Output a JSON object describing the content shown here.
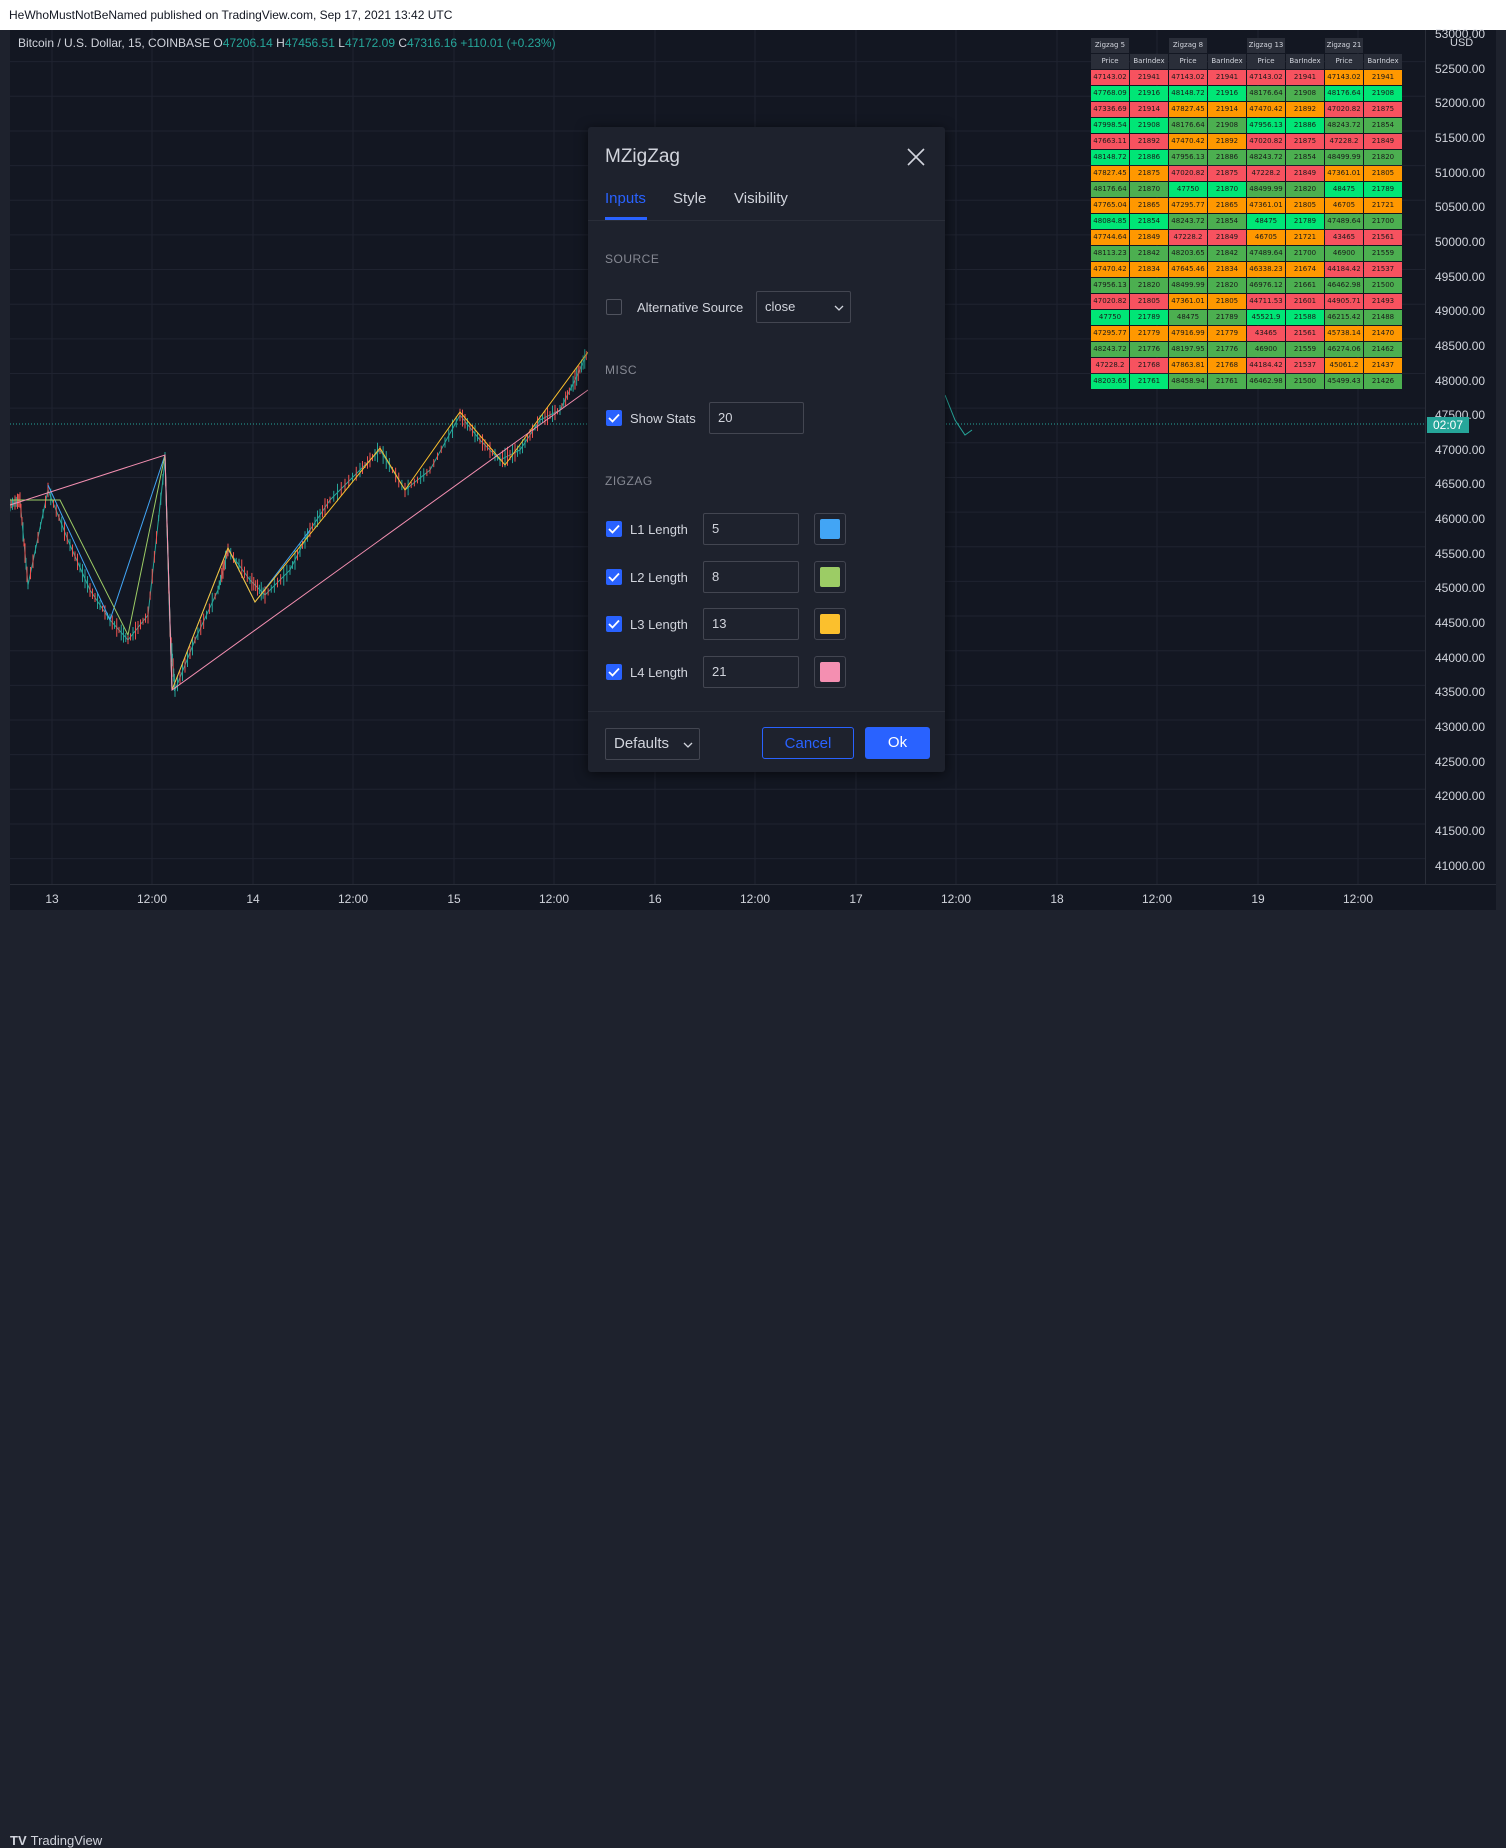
{
  "publish_info": "HeWhoMustNotBeNamed published on TradingView.com, Sep 17, 2021 13:42 UTC",
  "legend": {
    "symbol": "Bitcoin / U.S. Dollar, 15, COINBASE",
    "o_label": "O",
    "o_value": "47206.14",
    "h_label": "H",
    "h_value": "47456.51",
    "l_label": "L",
    "l_value": "47172.09",
    "c_label": "C",
    "c_value": "47316.16",
    "change": "+110.01 (+0.23%)"
  },
  "price_axis": {
    "currency": "USD",
    "ticks": [
      "53000.00",
      "52500.00",
      "52000.00",
      "51500.00",
      "51000.00",
      "50500.00",
      "50000.00",
      "49500.00",
      "49000.00",
      "48500.00",
      "48000.00",
      "47500.00",
      "47000.00",
      "46500.00",
      "46000.00",
      "45500.00",
      "45000.00",
      "44500.00",
      "44000.00",
      "43500.00",
      "43000.00",
      "42500.00",
      "42000.00",
      "41500.00",
      "41000.00"
    ],
    "countdown": "02:07",
    "current_price": 47316.16
  },
  "time_axis": {
    "labels": [
      "13",
      "12:00",
      "14",
      "12:00",
      "15",
      "12:00",
      "16",
      "12:00",
      "17",
      "12:00",
      "18",
      "12:00",
      "19",
      "12:00"
    ]
  },
  "brand": "TradingView",
  "stats_table": {
    "groups": [
      "Zigzag 5",
      "Zigzag 8",
      "Zigzag 13",
      "Zigzag 21"
    ],
    "col_headers": [
      "Price",
      "BarIndex"
    ],
    "colors": {
      "red": "#f7525f",
      "orange": "#ff9800",
      "lime": "#00e676",
      "green": "#4caf50"
    },
    "rows": [
      [
        [
          "47143.02",
          "red"
        ],
        [
          "21941",
          "red"
        ],
        [
          "47143.02",
          "red"
        ],
        [
          "21941",
          "red"
        ],
        [
          "47143.02",
          "red"
        ],
        [
          "21941",
          "red"
        ],
        [
          "47143.02",
          "orange"
        ],
        [
          "21941",
          "orange"
        ]
      ],
      [
        [
          "47768.09",
          "lime"
        ],
        [
          "21916",
          "lime"
        ],
        [
          "48148.72",
          "lime"
        ],
        [
          "21916",
          "lime"
        ],
        [
          "48176.64",
          "green"
        ],
        [
          "21908",
          "green"
        ],
        [
          "48176.64",
          "lime"
        ],
        [
          "21908",
          "lime"
        ]
      ],
      [
        [
          "47336.69",
          "red"
        ],
        [
          "21914",
          "red"
        ],
        [
          "47827.45",
          "orange"
        ],
        [
          "21914",
          "orange"
        ],
        [
          "47470.42",
          "orange"
        ],
        [
          "21892",
          "orange"
        ],
        [
          "47020.82",
          "red"
        ],
        [
          "21875",
          "red"
        ]
      ],
      [
        [
          "47998.54",
          "lime"
        ],
        [
          "21908",
          "lime"
        ],
        [
          "48176.64",
          "green"
        ],
        [
          "21908",
          "green"
        ],
        [
          "47956.13",
          "lime"
        ],
        [
          "21886",
          "lime"
        ],
        [
          "48243.72",
          "green"
        ],
        [
          "21854",
          "green"
        ]
      ],
      [
        [
          "47663.11",
          "red"
        ],
        [
          "21892",
          "red"
        ],
        [
          "47470.42",
          "orange"
        ],
        [
          "21892",
          "orange"
        ],
        [
          "47020.82",
          "red"
        ],
        [
          "21875",
          "red"
        ],
        [
          "47228.2",
          "red"
        ],
        [
          "21849",
          "red"
        ]
      ],
      [
        [
          "48148.72",
          "lime"
        ],
        [
          "21886",
          "lime"
        ],
        [
          "47956.13",
          "green"
        ],
        [
          "21886",
          "green"
        ],
        [
          "48243.72",
          "green"
        ],
        [
          "21854",
          "green"
        ],
        [
          "48499.99",
          "green"
        ],
        [
          "21820",
          "green"
        ]
      ],
      [
        [
          "47827.45",
          "orange"
        ],
        [
          "21875",
          "orange"
        ],
        [
          "47020.82",
          "red"
        ],
        [
          "21875",
          "red"
        ],
        [
          "47228.2",
          "red"
        ],
        [
          "21849",
          "red"
        ],
        [
          "47361.01",
          "orange"
        ],
        [
          "21805",
          "orange"
        ]
      ],
      [
        [
          "48176.64",
          "green"
        ],
        [
          "21870",
          "green"
        ],
        [
          "47750",
          "lime"
        ],
        [
          "21870",
          "lime"
        ],
        [
          "48499.99",
          "green"
        ],
        [
          "21820",
          "green"
        ],
        [
          "48475",
          "lime"
        ],
        [
          "21789",
          "lime"
        ]
      ],
      [
        [
          "47765.04",
          "orange"
        ],
        [
          "21865",
          "orange"
        ],
        [
          "47295.77",
          "orange"
        ],
        [
          "21865",
          "orange"
        ],
        [
          "47361.01",
          "orange"
        ],
        [
          "21805",
          "orange"
        ],
        [
          "46705",
          "orange"
        ],
        [
          "21721",
          "orange"
        ]
      ],
      [
        [
          "48084.85",
          "lime"
        ],
        [
          "21854",
          "lime"
        ],
        [
          "48243.72",
          "green"
        ],
        [
          "21854",
          "green"
        ],
        [
          "48475",
          "lime"
        ],
        [
          "21789",
          "lime"
        ],
        [
          "47489.64",
          "green"
        ],
        [
          "21700",
          "green"
        ]
      ],
      [
        [
          "47744.64",
          "orange"
        ],
        [
          "21849",
          "orange"
        ],
        [
          "47228.2",
          "red"
        ],
        [
          "21849",
          "red"
        ],
        [
          "46705",
          "orange"
        ],
        [
          "21721",
          "orange"
        ],
        [
          "43465",
          "red"
        ],
        [
          "21561",
          "red"
        ]
      ],
      [
        [
          "48113.23",
          "green"
        ],
        [
          "21842",
          "green"
        ],
        [
          "48203.65",
          "green"
        ],
        [
          "21842",
          "green"
        ],
        [
          "47489.64",
          "green"
        ],
        [
          "21700",
          "green"
        ],
        [
          "46900",
          "green"
        ],
        [
          "21559",
          "green"
        ]
      ],
      [
        [
          "47470.42",
          "orange"
        ],
        [
          "21834",
          "orange"
        ],
        [
          "47645.46",
          "orange"
        ],
        [
          "21834",
          "orange"
        ],
        [
          "46338.23",
          "orange"
        ],
        [
          "21674",
          "orange"
        ],
        [
          "44184.42",
          "red"
        ],
        [
          "21537",
          "red"
        ]
      ],
      [
        [
          "47956.13",
          "green"
        ],
        [
          "21820",
          "green"
        ],
        [
          "48499.99",
          "green"
        ],
        [
          "21820",
          "green"
        ],
        [
          "46976.12",
          "green"
        ],
        [
          "21661",
          "green"
        ],
        [
          "46462.98",
          "green"
        ],
        [
          "21500",
          "green"
        ]
      ],
      [
        [
          "47020.82",
          "red"
        ],
        [
          "21805",
          "red"
        ],
        [
          "47361.01",
          "orange"
        ],
        [
          "21805",
          "orange"
        ],
        [
          "44711.53",
          "red"
        ],
        [
          "21601",
          "red"
        ],
        [
          "44905.71",
          "red"
        ],
        [
          "21493",
          "red"
        ]
      ],
      [
        [
          "47750",
          "lime"
        ],
        [
          "21789",
          "lime"
        ],
        [
          "48475",
          "green"
        ],
        [
          "21789",
          "green"
        ],
        [
          "45521.9",
          "lime"
        ],
        [
          "21588",
          "lime"
        ],
        [
          "46215.42",
          "green"
        ],
        [
          "21488",
          "green"
        ]
      ],
      [
        [
          "47295.77",
          "orange"
        ],
        [
          "21779",
          "orange"
        ],
        [
          "47916.99",
          "orange"
        ],
        [
          "21779",
          "orange"
        ],
        [
          "43465",
          "red"
        ],
        [
          "21561",
          "red"
        ],
        [
          "45738.14",
          "orange"
        ],
        [
          "21470",
          "orange"
        ]
      ],
      [
        [
          "48243.72",
          "green"
        ],
        [
          "21776",
          "green"
        ],
        [
          "48197.95",
          "green"
        ],
        [
          "21776",
          "green"
        ],
        [
          "46900",
          "green"
        ],
        [
          "21559",
          "green"
        ],
        [
          "46274.06",
          "green"
        ],
        [
          "21462",
          "green"
        ]
      ],
      [
        [
          "47228.2",
          "red"
        ],
        [
          "21768",
          "red"
        ],
        [
          "47863.81",
          "orange"
        ],
        [
          "21768",
          "orange"
        ],
        [
          "44184.42",
          "red"
        ],
        [
          "21537",
          "red"
        ],
        [
          "45061.2",
          "orange"
        ],
        [
          "21437",
          "orange"
        ]
      ],
      [
        [
          "48203.65",
          "lime"
        ],
        [
          "21761",
          "lime"
        ],
        [
          "48458.94",
          "green"
        ],
        [
          "21761",
          "green"
        ],
        [
          "46462.98",
          "green"
        ],
        [
          "21500",
          "green"
        ],
        [
          "45499.43",
          "green"
        ],
        [
          "21426",
          "green"
        ]
      ]
    ]
  },
  "dialog": {
    "title": "MZigZag",
    "tabs": [
      "Inputs",
      "Style",
      "Visibility"
    ],
    "active_tab": "Inputs",
    "source_section": "SOURCE",
    "alt_source_label": "Alternative Source",
    "alt_source_checked": false,
    "alt_source_value": "close",
    "misc_section": "MISC",
    "show_stats_label": "Show Stats",
    "show_stats_checked": true,
    "show_stats_value": "20",
    "zigzag_section": "ZIGZAG",
    "levels": [
      {
        "label": "L1 Length",
        "value": "5",
        "color": "#42a5f5",
        "checked": true
      },
      {
        "label": "L2 Length",
        "value": "8",
        "color": "#9ccc65",
        "checked": true
      },
      {
        "label": "L3 Length",
        "value": "13",
        "color": "#fbc02d",
        "checked": true
      },
      {
        "label": "L4 Length",
        "value": "21",
        "color": "#f48fb1",
        "checked": true
      }
    ],
    "defaults_label": "Defaults",
    "cancel_label": "Cancel",
    "ok_label": "Ok",
    "accent": "#2962ff"
  }
}
